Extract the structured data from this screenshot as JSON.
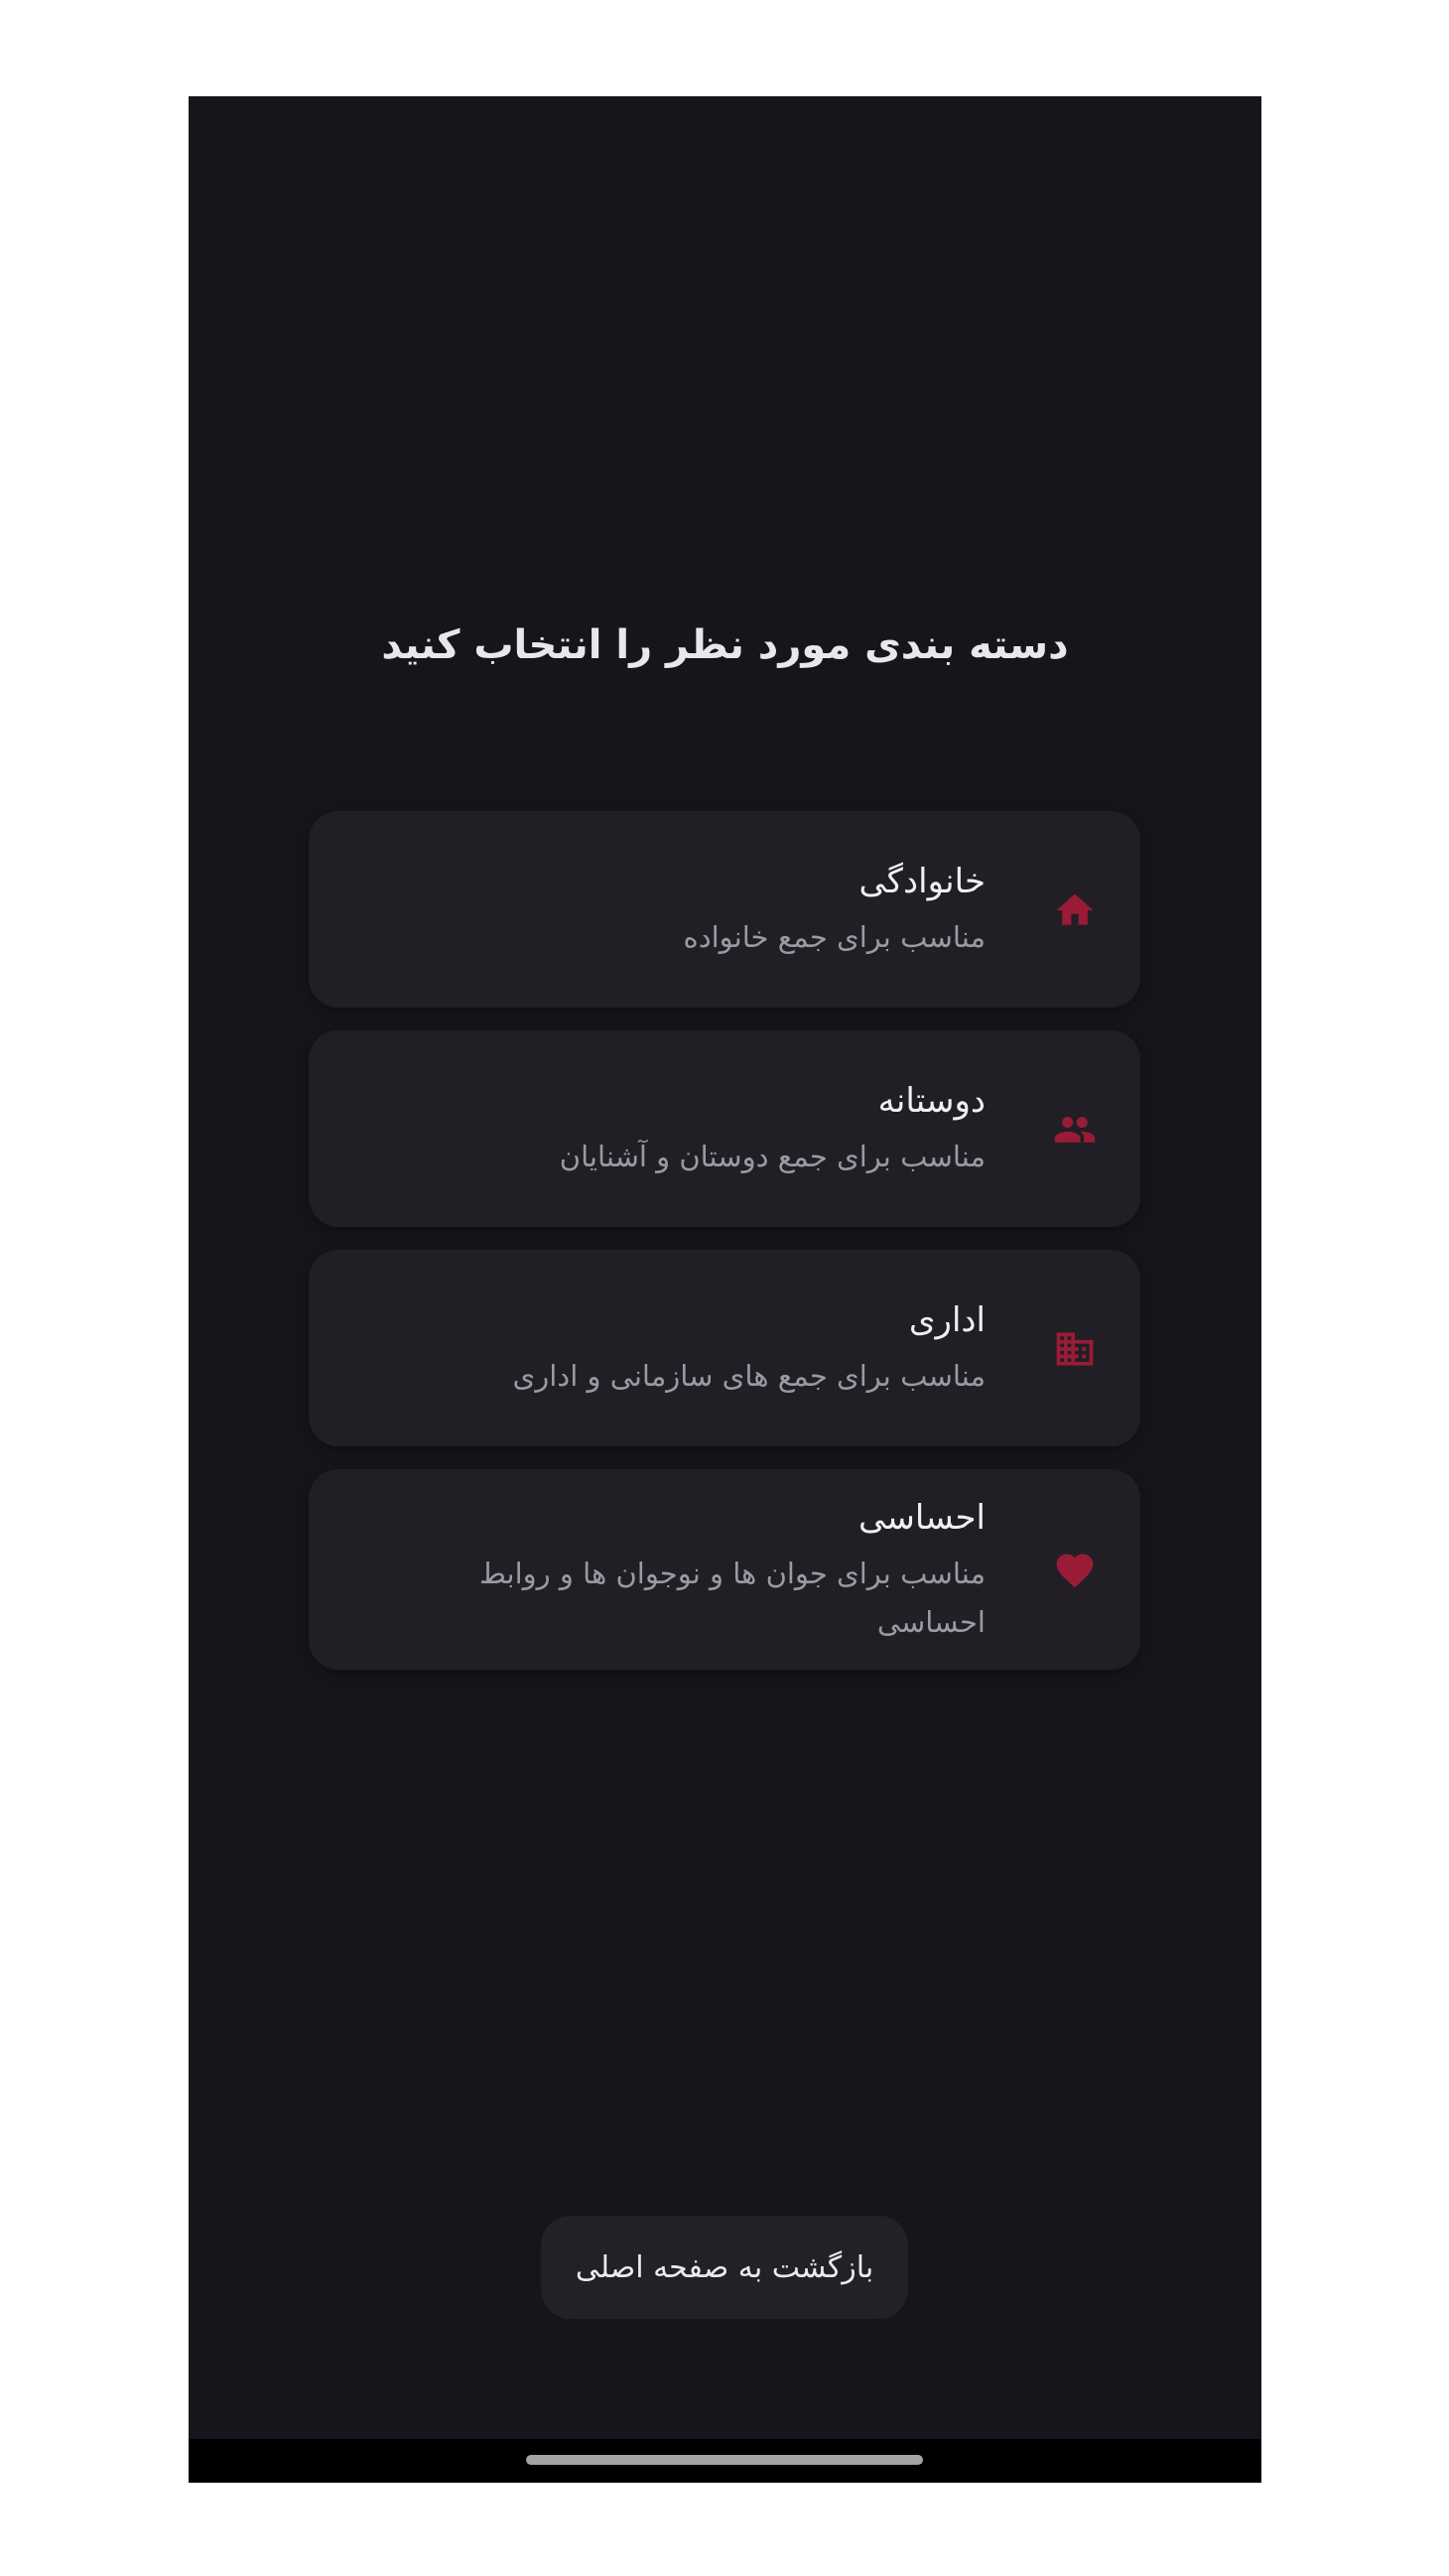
{
  "screen": {
    "title": "دسته بندی مورد نظر را انتخاب کنید"
  },
  "categories": [
    {
      "name": "خانوادگی",
      "description": "مناسب برای جمع خانواده",
      "icon": "home-icon"
    },
    {
      "name": "دوستانه",
      "description": "مناسب برای جمع دوستان و آشنایان",
      "icon": "group-icon"
    },
    {
      "name": "اداری",
      "description": "مناسب برای جمع های سازمانی و اداری",
      "icon": "office-building-icon"
    },
    {
      "name": "احساسی",
      "description": "مناسب برای جوان ها و نوجوان ها و روابط احساسی",
      "icon": "heart-icon"
    }
  ],
  "footer": {
    "back_label": "بازگشت به صفحه اصلی"
  },
  "colors": {
    "background": "#17151b",
    "card": "#211f25",
    "accent": "#9a1b36",
    "text_primary": "#f1eff4",
    "text_secondary": "#9c99a2"
  }
}
